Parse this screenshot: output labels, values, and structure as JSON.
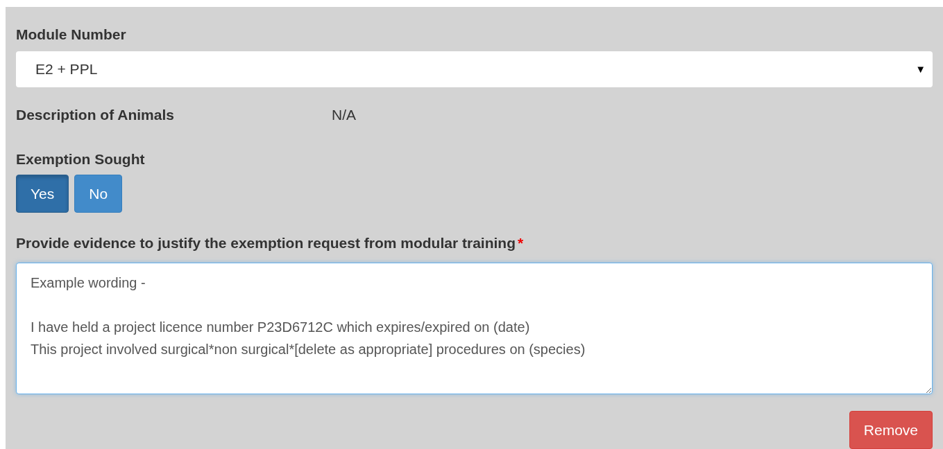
{
  "module_number": {
    "label": "Module Number",
    "value": "E2 + PPL",
    "caret": "▼"
  },
  "description_of_animals": {
    "label": "Description of Animals",
    "value": "N/A"
  },
  "exemption_sought": {
    "label": "Exemption Sought",
    "options": [
      {
        "label": "Yes",
        "selected": true
      },
      {
        "label": "No",
        "selected": false
      }
    ]
  },
  "evidence": {
    "label": "Provide evidence to justify the exemption request from modular training",
    "required_mark": "*",
    "value": "Example wording -\n\nI have held a project licence number P23D6712C which expires/expired on (date)\nThis project involved surgical*non surgical*[delete as appropriate] procedures on (species)"
  },
  "remove_button": "Remove"
}
